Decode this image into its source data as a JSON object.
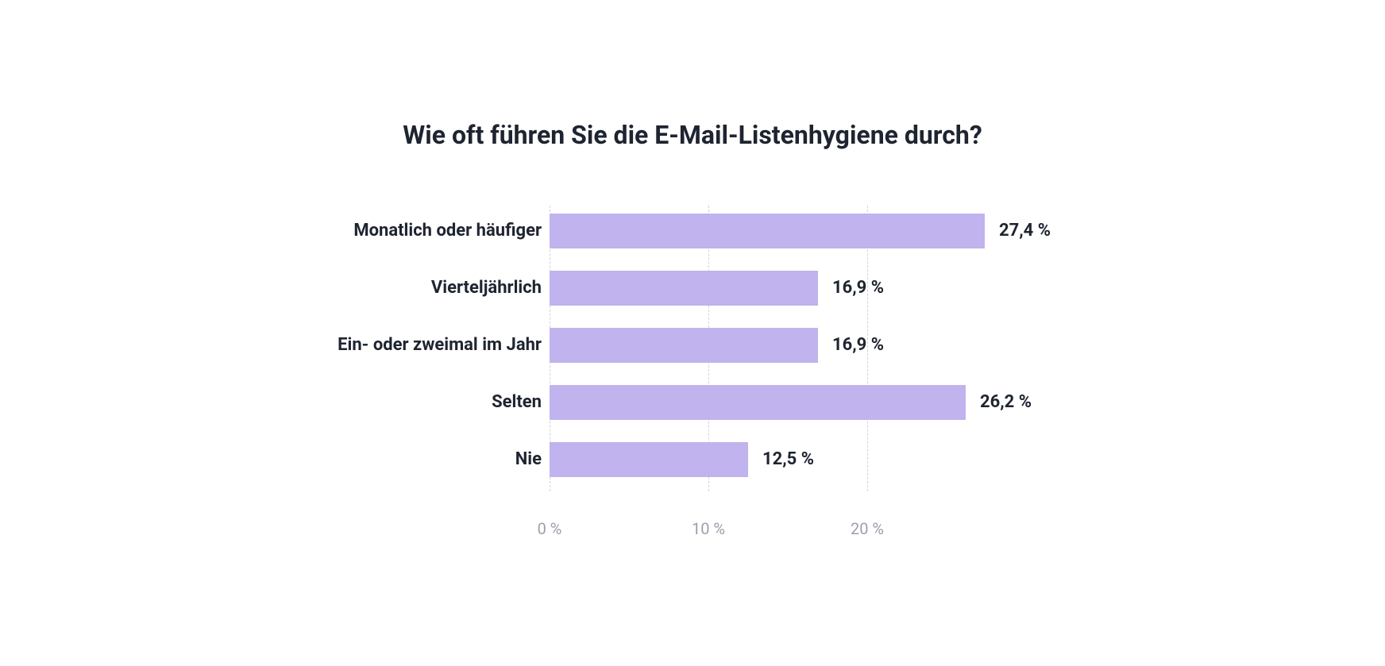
{
  "chart_data": {
    "type": "bar",
    "orientation": "horizontal",
    "title": "Wie oft führen Sie die E-Mail-Listenhygiene durch?",
    "categories": [
      "Monatlich oder häufiger",
      "Vierteljährlich",
      "Ein- oder zweimal im Jahr",
      "Selten",
      "Nie"
    ],
    "values": [
      27.4,
      16.9,
      16.9,
      26.2,
      12.5
    ],
    "value_labels": [
      "27,4 %",
      "16,9 %",
      "16,9 %",
      "26,2 %",
      "12,5 %"
    ],
    "xlabel": "",
    "ylabel": "",
    "xlim": [
      0,
      30
    ],
    "x_ticks": [
      0,
      10,
      20
    ],
    "x_tick_labels": [
      "0 %",
      "10 %",
      "20 %"
    ],
    "bar_color": "#c1b3ed",
    "grid": "dashed-vertical"
  }
}
